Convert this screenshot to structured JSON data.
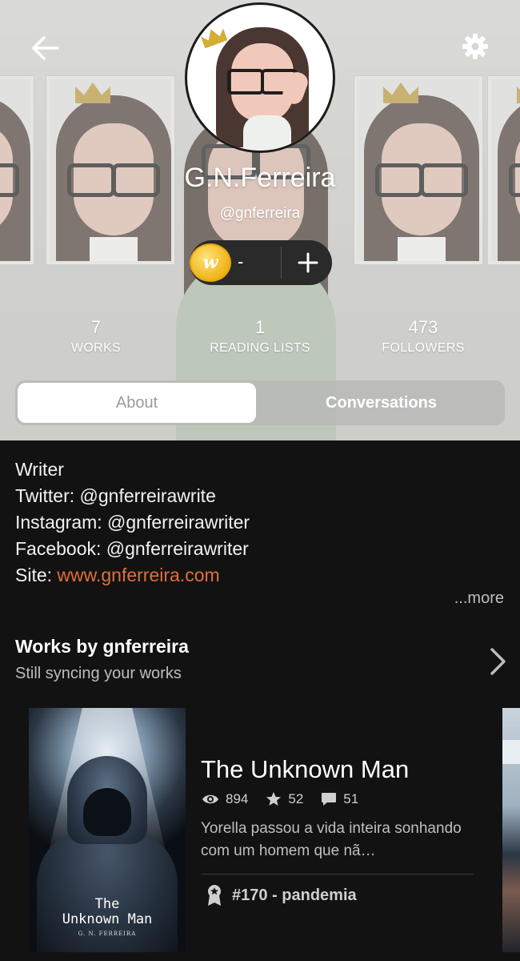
{
  "profile": {
    "name": "G.N.Ferreira",
    "handle": "@gnferreira",
    "coins": "-"
  },
  "stats": [
    {
      "value": "7",
      "label": "WORKS"
    },
    {
      "value": "1",
      "label": "READING LISTS"
    },
    {
      "value": "473",
      "label": "FOLLOWERS"
    }
  ],
  "tabs": {
    "about": "About",
    "conversations": "Conversations",
    "active": "About"
  },
  "about": {
    "lines": [
      "Writer",
      "Twitter: @gnferreirawrite",
      "Instagram: @gnferreirawriter",
      "Facebook: @gnferreirawriter"
    ],
    "site_label": "Site: ",
    "site_url": "www.gnferreira.com",
    "more": "...more"
  },
  "works": {
    "title": "Works by gnferreira",
    "subtitle": "Still syncing your works",
    "story": {
      "title": "The Unknown Man",
      "reads": "894",
      "votes": "52",
      "comments": "51",
      "description": "Yorella passou a vida inteira sonhando com um homem que nã…",
      "rank": "#170 - pandemia",
      "cover_title_line1": "The",
      "cover_title_line2": "Unknown Man",
      "cover_author": "G. N. FERREIRA"
    }
  },
  "icons": {
    "back": "arrow-left-icon",
    "settings": "gear-icon",
    "coin": "wattpad-coin-icon",
    "add": "plus-icon",
    "chevron": "chevron-right-icon",
    "reads": "eye-icon",
    "votes": "star-icon",
    "comments": "comment-icon",
    "rank": "ribbon-icon"
  },
  "colors": {
    "link": "#e06f3d",
    "background": "#121212",
    "coin": "#f0b419"
  }
}
